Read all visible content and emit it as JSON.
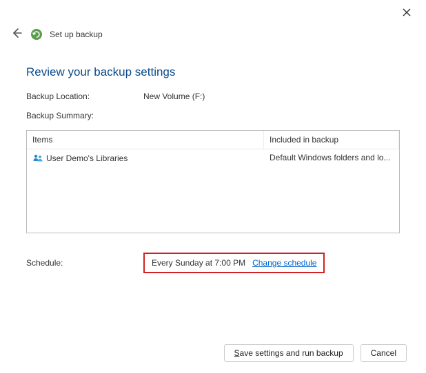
{
  "window": {
    "title": "Set up backup"
  },
  "heading": "Review your backup settings",
  "location": {
    "label": "Backup Location:",
    "value": "New Volume (F:)"
  },
  "summary": {
    "label": "Backup Summary:"
  },
  "table": {
    "headers": {
      "items": "Items",
      "included": "Included in backup"
    },
    "rows": [
      {
        "item": "User Demo's Libraries",
        "included": "Default Windows folders and lo..."
      }
    ]
  },
  "schedule": {
    "label": "Schedule:",
    "value": "Every Sunday at 7:00 PM",
    "link": "Change schedule"
  },
  "buttons": {
    "save": "Save settings and run backup",
    "cancel": "Cancel"
  }
}
